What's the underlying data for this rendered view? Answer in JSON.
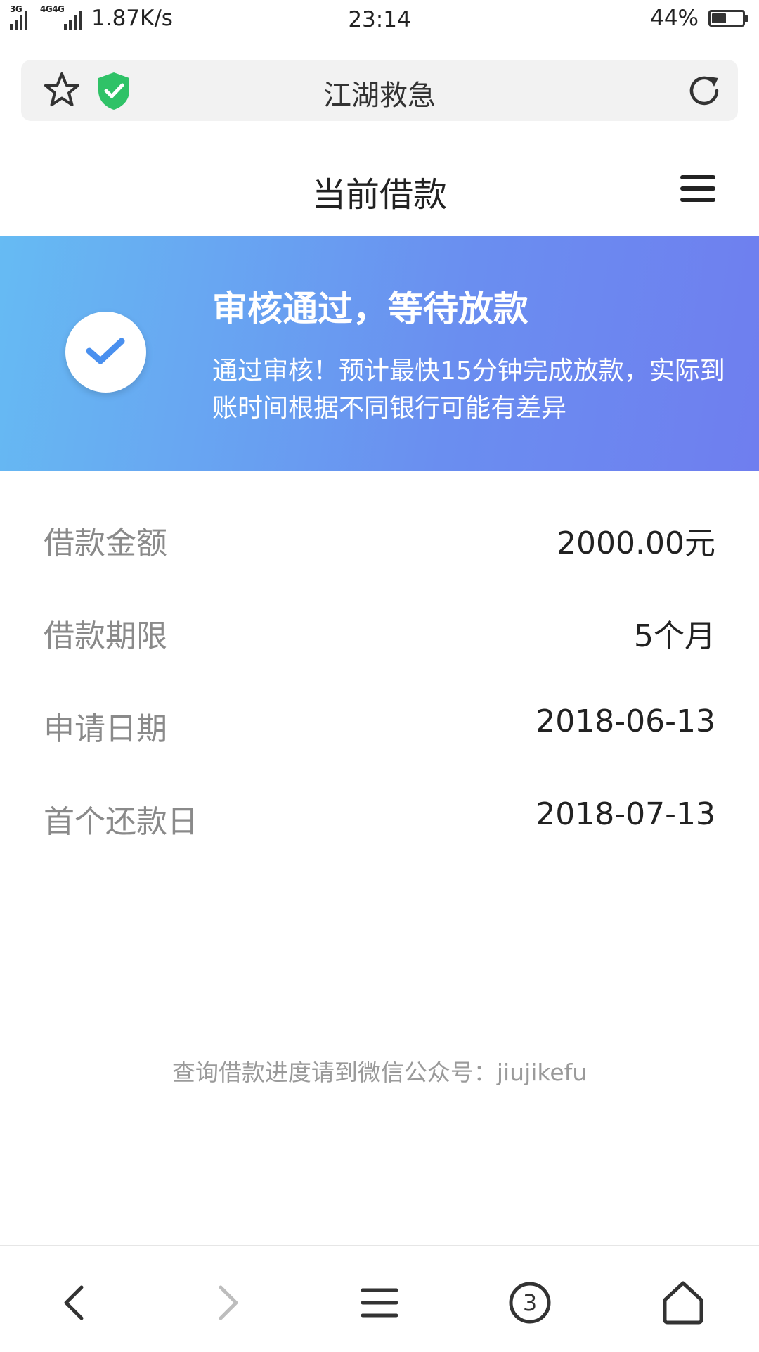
{
  "status_bar": {
    "network_1": "3G",
    "network_2": "4G",
    "network_3": "4G",
    "speed": "1.87K/s",
    "time": "23:14",
    "battery": "44%",
    "battery_level": 0.44
  },
  "browser": {
    "title": "江湖救急",
    "icons": [
      "star-icon",
      "shield-check-icon",
      "refresh-icon"
    ]
  },
  "header": {
    "title": "当前借款",
    "menu_icon": "hamburger-menu-icon"
  },
  "banner": {
    "title": "审核通过，等待放款",
    "description": "通过审核！预计最快15分钟完成放款，实际到账时间根据不同银行可能有差异",
    "icon": "check-circle-icon",
    "colors": {
      "start": "#66bbf3",
      "end": "#6f7eef"
    }
  },
  "details": [
    {
      "label": "借款金额",
      "value": "2000.00元"
    },
    {
      "label": "借款期限",
      "value": "5个月"
    },
    {
      "label": "申请日期",
      "value": "2018-06-13"
    },
    {
      "label": "首个还款日",
      "value": "2018-07-13"
    }
  ],
  "footer": {
    "note": "查询借款进度请到微信公众号：jiujikefu"
  },
  "bottom_nav": {
    "tab_count": "3",
    "icons": [
      "back-icon",
      "forward-icon",
      "menu-icon",
      "tabs-icon",
      "home-icon"
    ]
  }
}
